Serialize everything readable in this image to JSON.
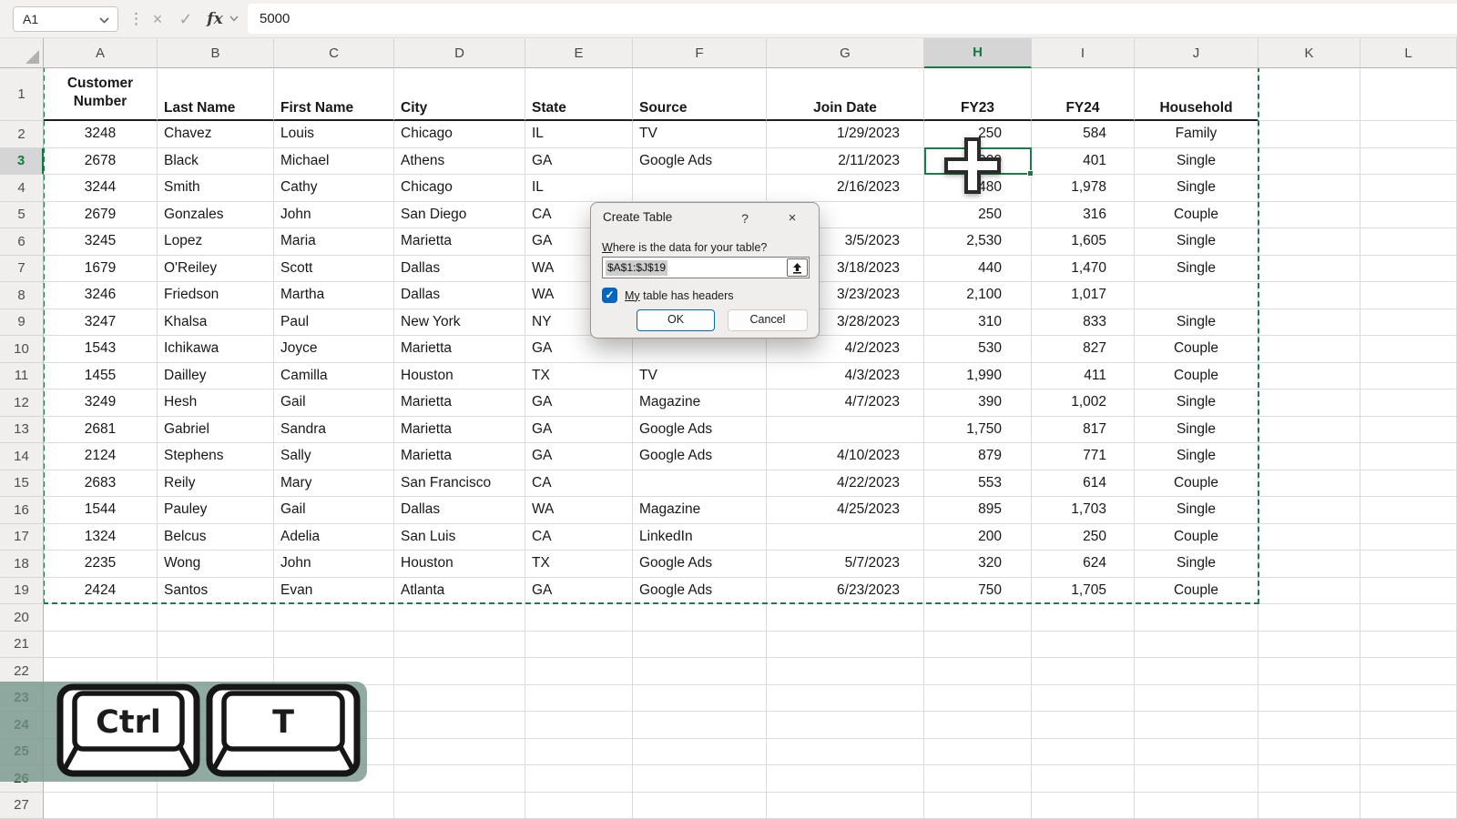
{
  "formula_bar": {
    "name_box": "A1",
    "fx_label": "fx",
    "formula": "5000"
  },
  "grid": {
    "columns": [
      "A",
      "B",
      "C",
      "D",
      "E",
      "F",
      "G",
      "H",
      "I",
      "J",
      "K",
      "L"
    ],
    "row_count": 27,
    "selected_column": "H",
    "selected_row": 3,
    "active_cell": "H3",
    "overlay_tinted_rows": [
      23,
      24,
      25,
      26
    ]
  },
  "table": {
    "headers": [
      "Customer Number",
      "Last Name",
      "First Name",
      "City",
      "State",
      "Source",
      "Join Date",
      "FY23",
      "FY24",
      "Household"
    ],
    "rows": [
      [
        "3248",
        "Chavez",
        "Louis",
        "Chicago",
        "IL",
        "TV",
        "1/29/2023",
        "250",
        "584",
        "Family"
      ],
      [
        "2678",
        "Black",
        "Michael",
        "Athens",
        "GA",
        "Google Ads",
        "2/11/2023",
        "5,000",
        "401",
        "Single"
      ],
      [
        "3244",
        "Smith",
        "Cathy",
        "Chicago",
        "IL",
        "",
        "2/16/2023",
        "480",
        "1,978",
        "Single"
      ],
      [
        "2679",
        "Gonzales",
        "John",
        "San Diego",
        "CA",
        "",
        "",
        "250",
        "316",
        "Couple"
      ],
      [
        "3245",
        "Lopez",
        "Maria",
        "Marietta",
        "GA",
        "",
        "3/5/2023",
        "2,530",
        "1,605",
        "Single"
      ],
      [
        "1679",
        "O'Reiley",
        "Scott",
        "Dallas",
        "WA",
        "",
        "3/18/2023",
        "440",
        "1,470",
        "Single"
      ],
      [
        "3246",
        "Friedson",
        "Martha",
        "Dallas",
        "WA",
        "",
        "3/23/2023",
        "2,100",
        "1,017",
        ""
      ],
      [
        "3247",
        "Khalsa",
        "Paul",
        "New York",
        "NY",
        "",
        "3/28/2023",
        "310",
        "833",
        "Single"
      ],
      [
        "1543",
        "Ichikawa",
        "Joyce",
        "Marietta",
        "GA",
        "",
        "4/2/2023",
        "530",
        "827",
        "Couple"
      ],
      [
        "1455",
        "Dailley",
        "Camilla",
        "Houston",
        "TX",
        "TV",
        "4/3/2023",
        "1,990",
        "411",
        "Couple"
      ],
      [
        "3249",
        "Hesh",
        "Gail",
        "Marietta",
        "GA",
        "Magazine",
        "4/7/2023",
        "390",
        "1,002",
        "Single"
      ],
      [
        "2681",
        "Gabriel",
        "Sandra",
        "Marietta",
        "GA",
        "Google Ads",
        "",
        "1,750",
        "817",
        "Single"
      ],
      [
        "2124",
        "Stephens",
        "Sally",
        "Marietta",
        "GA",
        "Google Ads",
        "4/10/2023",
        "879",
        "771",
        "Single"
      ],
      [
        "2683",
        "Reily",
        "Mary",
        "San Francisco",
        "CA",
        "",
        "4/22/2023",
        "553",
        "614",
        "Couple"
      ],
      [
        "1544",
        "Pauley",
        "Gail",
        "Dallas",
        "WA",
        "Magazine",
        "4/25/2023",
        "895",
        "1,703",
        "Single"
      ],
      [
        "1324",
        "Belcus",
        "Adelia",
        "San Luis",
        "CA",
        "LinkedIn",
        "",
        "200",
        "250",
        "Couple"
      ],
      [
        "2235",
        "Wong",
        "John",
        "Houston",
        "TX",
        "Google Ads",
        "5/7/2023",
        "320",
        "624",
        "Single"
      ],
      [
        "2424",
        "Santos",
        "Evan",
        "Atlanta",
        "GA",
        "Google Ads",
        "6/23/2023",
        "750",
        "1,705",
        "Couple"
      ]
    ]
  },
  "dialog": {
    "title": "Create Table",
    "help_icon": "?",
    "close_icon": "×",
    "prompt_accel": "W",
    "prompt_rest": "here is the data for your table?",
    "range": "$A$1:$J$19",
    "checkbox_checked": true,
    "checkbox_check_glyph": "✓",
    "checkbox_accel": "My",
    "checkbox_rest": " table has headers",
    "ok_label": "OK",
    "cancel_label": "Cancel"
  },
  "shortcut": {
    "key1": "Ctrl",
    "key2": "T"
  },
  "colors": {
    "excel_green": "#107c41",
    "ants_green": "#1f7a4d",
    "dialog_accent_blue": "#0067c0",
    "overlay_sage": "#79988d"
  }
}
